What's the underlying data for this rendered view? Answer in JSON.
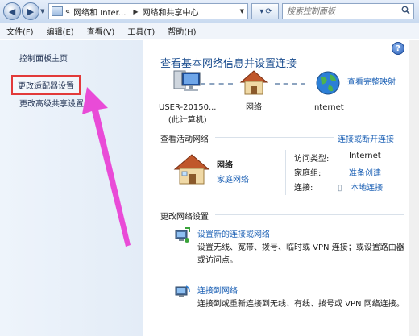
{
  "address_bar": {
    "crumbs": [
      "«",
      "网络和 Inter...",
      "网络和共享中心"
    ],
    "search_placeholder": "搜索控制面板"
  },
  "menu": [
    "文件(F)",
    "编辑(E)",
    "查看(V)",
    "工具(T)",
    "帮助(H)"
  ],
  "left_pane": {
    "home": "控制面板主页",
    "change_adapter": "更改适配器设置",
    "change_advanced": "更改高级共享设置"
  },
  "main": {
    "title": "查看基本网络信息并设置连接",
    "full_map": "查看完整映射",
    "map": {
      "computer": "USER-20150...",
      "computer_sub": "(此计算机)",
      "network": "网络",
      "internet": "Internet"
    },
    "active_networks": {
      "heading": "查看活动网络",
      "connect_disconnect": "连接或断开连接",
      "name": "网络",
      "type": "家庭网络",
      "access_type_label": "访问类型:",
      "access_type_value": "Internet",
      "homegroup_label": "家庭组:",
      "homegroup_value": "准备创建",
      "connections_label": "连接:",
      "connections_value": "本地连接"
    },
    "change_settings": {
      "heading": "更改网络设置",
      "tasks": [
        {
          "link": "设置新的连接或网络",
          "desc": "设置无线、宽带、拨号、临时或 VPN 连接；或设置路由器或访问点。"
        },
        {
          "link": "连接到网络",
          "desc": "连接到或重新连接到无线、有线、拨号或 VPN 网络连接。"
        }
      ]
    }
  },
  "colors": {
    "link": "#1a5fb4",
    "title": "#1b4d8f",
    "highlight": "#e23a3a",
    "arrow": "#e94bd7"
  }
}
